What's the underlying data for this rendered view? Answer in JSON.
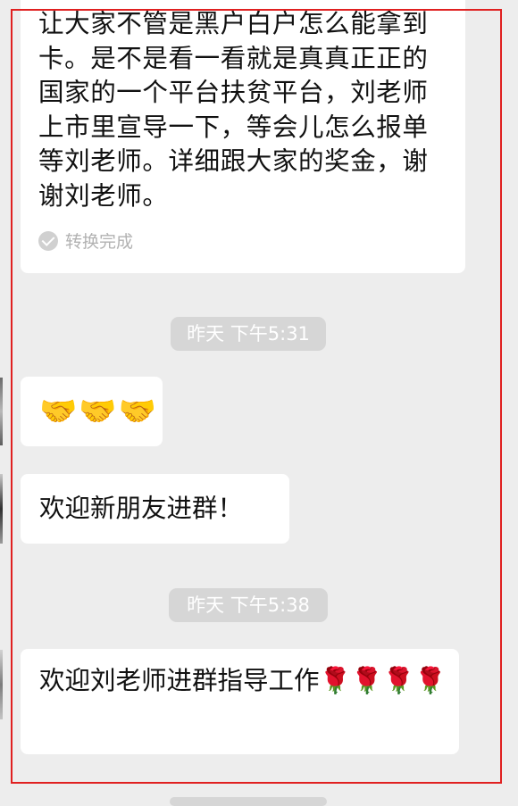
{
  "messages": {
    "first": {
      "text": "让大家不管是黑户白户怎么能拿到卡。是不是看一看就是真真正正的国家的一个平台扶贫平台，刘老师上市里宣导一下，等会儿怎么报单等刘老师。详细跟大家的奖金，谢谢刘老师。",
      "status": "转换完成",
      "status_icon": "check-circle-icon"
    },
    "handshake": {
      "text": "🤝🤝🤝"
    },
    "welcome_new": {
      "text": "欢迎新朋友进群！"
    },
    "welcome_teacher": {
      "text": "欢迎刘老师进群指导工作🌹🌹🌹🌹"
    }
  },
  "timestamps": {
    "first": "昨天 下午5:31",
    "second": "昨天 下午5:38"
  },
  "colors": {
    "background": "#ededed",
    "bubble": "#ffffff",
    "timestamp_pill": "#d6d6d6",
    "highlight_frame": "#e02020"
  }
}
